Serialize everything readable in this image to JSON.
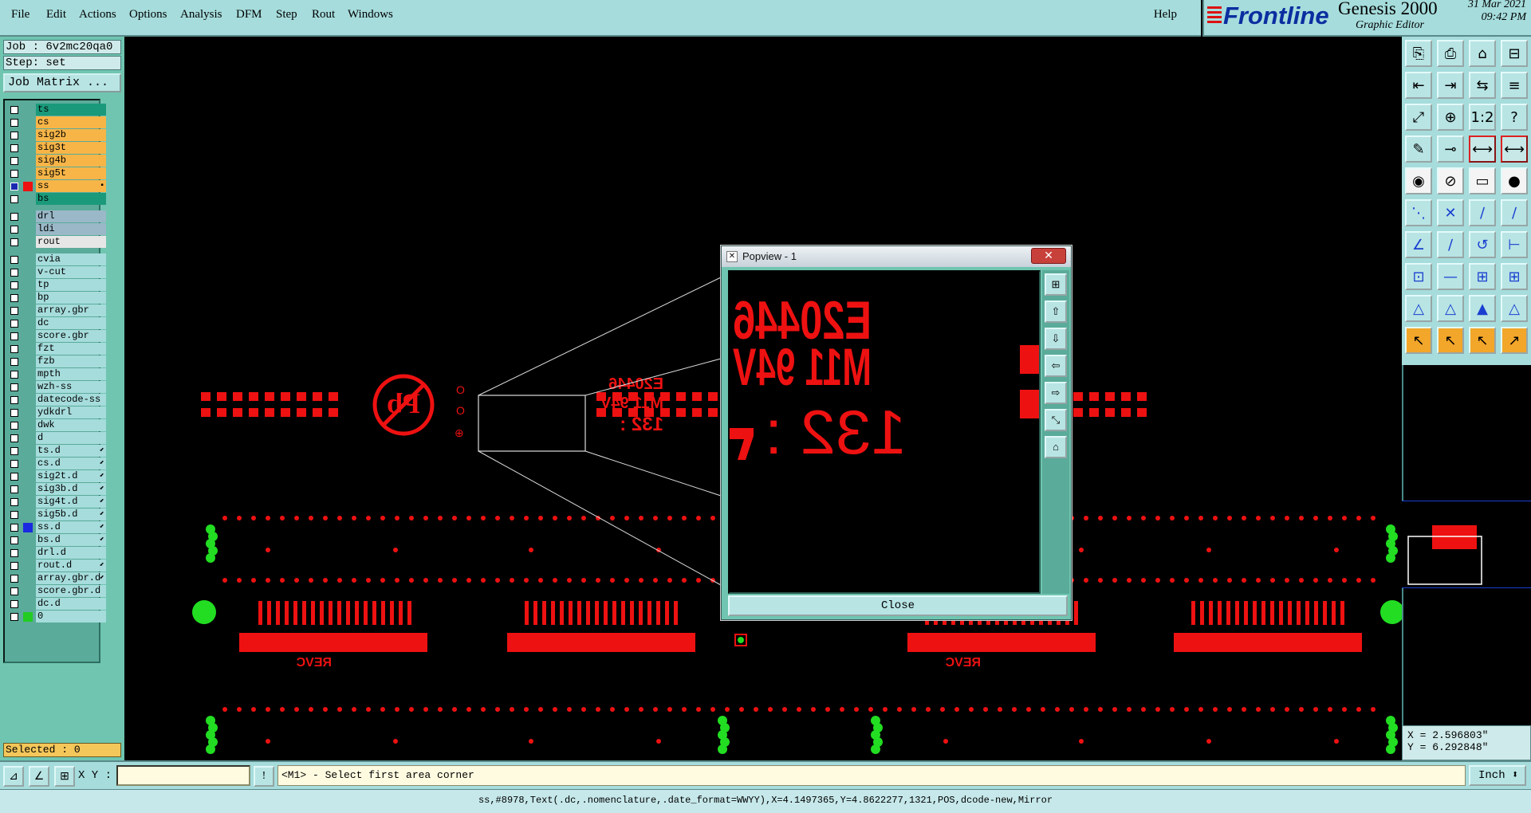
{
  "menubar": {
    "items": [
      "File",
      "Edit",
      "Actions",
      "Options",
      "Analysis",
      "DFM",
      "Step",
      "Rout",
      "Windows"
    ],
    "help": "Help"
  },
  "brand": {
    "logo": "Frontline",
    "product": "Genesis 2000",
    "subtitle": "Graphic Editor",
    "date": "31 Mar 2021",
    "time": "09:42 PM"
  },
  "left_panel": {
    "job": "Job : 6v2mc20qa0",
    "step": "Step: set",
    "job_matrix": "Job Matrix ...",
    "selected": "Selected : 0",
    "layers": [
      {
        "name": "ts",
        "bg": "#1a9a7a",
        "swatch": "",
        "mark": ""
      },
      {
        "name": "cs",
        "bg": "#f7b548",
        "swatch": "",
        "mark": ""
      },
      {
        "name": "sig2b",
        "bg": "#f7b548",
        "swatch": "",
        "mark": ""
      },
      {
        "name": "sig3t",
        "bg": "#f7b548",
        "swatch": "",
        "mark": ""
      },
      {
        "name": "sig4b",
        "bg": "#f7b548",
        "swatch": "",
        "mark": ""
      },
      {
        "name": "sig5t",
        "bg": "#f7b548",
        "swatch": "",
        "mark": ""
      },
      {
        "name": "ss",
        "bg": "#f7b548",
        "swatch": "#ee1111",
        "mark": "▪",
        "active": true
      },
      {
        "name": "bs",
        "bg": "#1a9a7a",
        "swatch": "",
        "mark": ""
      },
      {
        "gap": true
      },
      {
        "name": "drl",
        "bg": "#9ab8c8",
        "swatch": "",
        "mark": ""
      },
      {
        "name": "ldi",
        "bg": "#9ab8c8",
        "swatch": "",
        "mark": ""
      },
      {
        "name": "rout",
        "bg": "#e6e6e6",
        "swatch": "",
        "mark": ""
      },
      {
        "gap": true
      },
      {
        "name": "cvia",
        "bg": "#a6dcdc",
        "swatch": "",
        "mark": ""
      },
      {
        "name": "v-cut",
        "bg": "#a6dcdc",
        "swatch": "",
        "mark": ""
      },
      {
        "name": "tp",
        "bg": "#a6dcdc",
        "swatch": "",
        "mark": ""
      },
      {
        "name": "bp",
        "bg": "#a6dcdc",
        "swatch": "",
        "mark": ""
      },
      {
        "name": "array.gbr",
        "bg": "#a6dcdc",
        "swatch": "",
        "mark": ""
      },
      {
        "name": "dc",
        "bg": "#a6dcdc",
        "swatch": "",
        "mark": ""
      },
      {
        "name": "score.gbr",
        "bg": "#a6dcdc",
        "swatch": "",
        "mark": ""
      },
      {
        "name": "fzt",
        "bg": "#a6dcdc",
        "swatch": "",
        "mark": ""
      },
      {
        "name": "fzb",
        "bg": "#a6dcdc",
        "swatch": "",
        "mark": ""
      },
      {
        "name": "mpth",
        "bg": "#a6dcdc",
        "swatch": "",
        "mark": ""
      },
      {
        "name": "wzh-ss",
        "bg": "#a6dcdc",
        "swatch": "",
        "mark": ""
      },
      {
        "name": "datecode-ss",
        "bg": "#a6dcdc",
        "swatch": "",
        "mark": ""
      },
      {
        "name": "ydkdrl",
        "bg": "#a6dcdc",
        "swatch": "",
        "mark": ""
      },
      {
        "name": "dwk",
        "bg": "#a6dcdc",
        "swatch": "",
        "mark": ""
      },
      {
        "name": "d",
        "bg": "#a6dcdc",
        "swatch": "",
        "mark": ""
      },
      {
        "name": "ts.d",
        "bg": "#a6dcdc",
        "swatch": "",
        "mark": "⬋"
      },
      {
        "name": "cs.d",
        "bg": "#a6dcdc",
        "swatch": "",
        "mark": "⬋"
      },
      {
        "name": "sig2t.d",
        "bg": "#a6dcdc",
        "swatch": "",
        "mark": "⬋"
      },
      {
        "name": "sig3b.d",
        "bg": "#a6dcdc",
        "swatch": "",
        "mark": "⬋"
      },
      {
        "name": "sig4t.d",
        "bg": "#a6dcdc",
        "swatch": "",
        "mark": "⬋"
      },
      {
        "name": "sig5b.d",
        "bg": "#a6dcdc",
        "swatch": "",
        "mark": "⬋"
      },
      {
        "name": "ss.d",
        "bg": "#a6dcdc",
        "swatch": "#1a2ae0",
        "mark": "⬋"
      },
      {
        "name": "bs.d",
        "bg": "#a6dcdc",
        "swatch": "",
        "mark": "⬋"
      },
      {
        "name": "drl.d",
        "bg": "#a6dcdc",
        "swatch": "",
        "mark": ""
      },
      {
        "name": "rout.d",
        "bg": "#a6dcdc",
        "swatch": "",
        "mark": "⬋"
      },
      {
        "name": "array.gbr.d",
        "bg": "#a6dcdc",
        "swatch": "",
        "mark": "⬋"
      },
      {
        "name": "score.gbr.d",
        "bg": "#a6dcdc",
        "swatch": "",
        "mark": ""
      },
      {
        "name": "dc.d",
        "bg": "#a6dcdc",
        "swatch": "",
        "mark": ""
      },
      {
        "name": "0",
        "bg": "#a6dcdc",
        "swatch": "#22cc22",
        "mark": ""
      }
    ]
  },
  "canvas": {
    "label_lines": [
      "E20446",
      "M11 94V",
      "132 :"
    ],
    "rev_label": "REVC",
    "pb_symbol": "Pb"
  },
  "popview": {
    "title": "Popview - 1",
    "close_x": "✕",
    "close_label": "Close",
    "lines": [
      "E20446",
      "M11 94V",
      "132 :"
    ]
  },
  "coords": {
    "x": "X = 2.596803\"",
    "y": "Y = 6.292848\""
  },
  "cmdbar": {
    "xy_label": "X Y :",
    "xy_value": "",
    "prompt": "<M1> - Select first area corner",
    "unit": "Inch ⬍"
  },
  "statusbar": {
    "text": "ss,#8978,Text(.dc,.nomenclature,.date_format=WWYY),X=4.1497365,Y=4.8622277,1321,POS,dcode-new,Mirror"
  },
  "colors": {
    "copper": "#ee1111",
    "green": "#22dd22",
    "panel": "#a6dcdc",
    "accent": "#0a2ea0"
  }
}
